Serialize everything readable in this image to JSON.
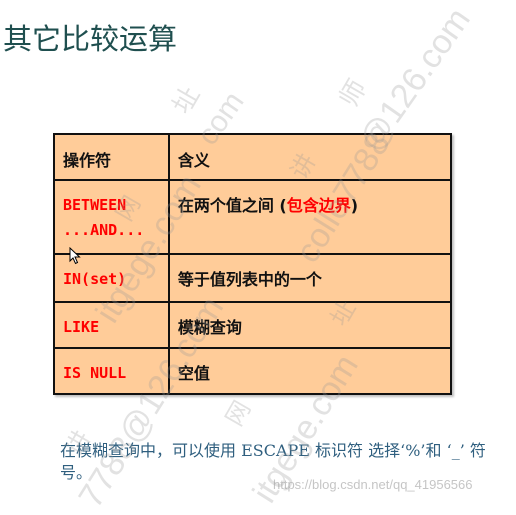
{
  "slide": {
    "title": "其它比较运算"
  },
  "table": {
    "headers": [
      "操作符",
      "含义"
    ],
    "rows": [
      {
        "operator": "BETWEEN\n...AND...",
        "meaning_prefix": "在两个值之间 (",
        "meaning_highlight": "包含边界",
        "meaning_suffix": ")"
      },
      {
        "operator": "IN(set)",
        "meaning_prefix": "等于值列表中的一个",
        "meaning_highlight": "",
        "meaning_suffix": ""
      },
      {
        "operator": "LIKE",
        "meaning_prefix": "模糊查询",
        "meaning_highlight": "",
        "meaning_suffix": ""
      },
      {
        "operator": "IS NULL",
        "meaning_prefix": "空值",
        "meaning_highlight": "",
        "meaning_suffix": ""
      }
    ]
  },
  "note": {
    "text": "在模糊查询中，可以使用 ESCAPE 标识符 选择‘%’和 ‘_’ 符号。"
  },
  "watermarks": {
    "site_url": "https://blog.csdn.net/qq_41956566",
    "items": [
      "址",
      "com",
      "师",
      "@126.com",
      "网",
      "itgege.com",
      "讲",
      "colle7788",
      "7788@126.com",
      "网",
      "itgege.com",
      "址",
      "讲"
    ]
  },
  "colors": {
    "title": "#1f4f4f",
    "table_fill": "#ffcc99",
    "operator": "#ff0000",
    "highlight": "#ff0000",
    "note": "#2f5f7f"
  }
}
